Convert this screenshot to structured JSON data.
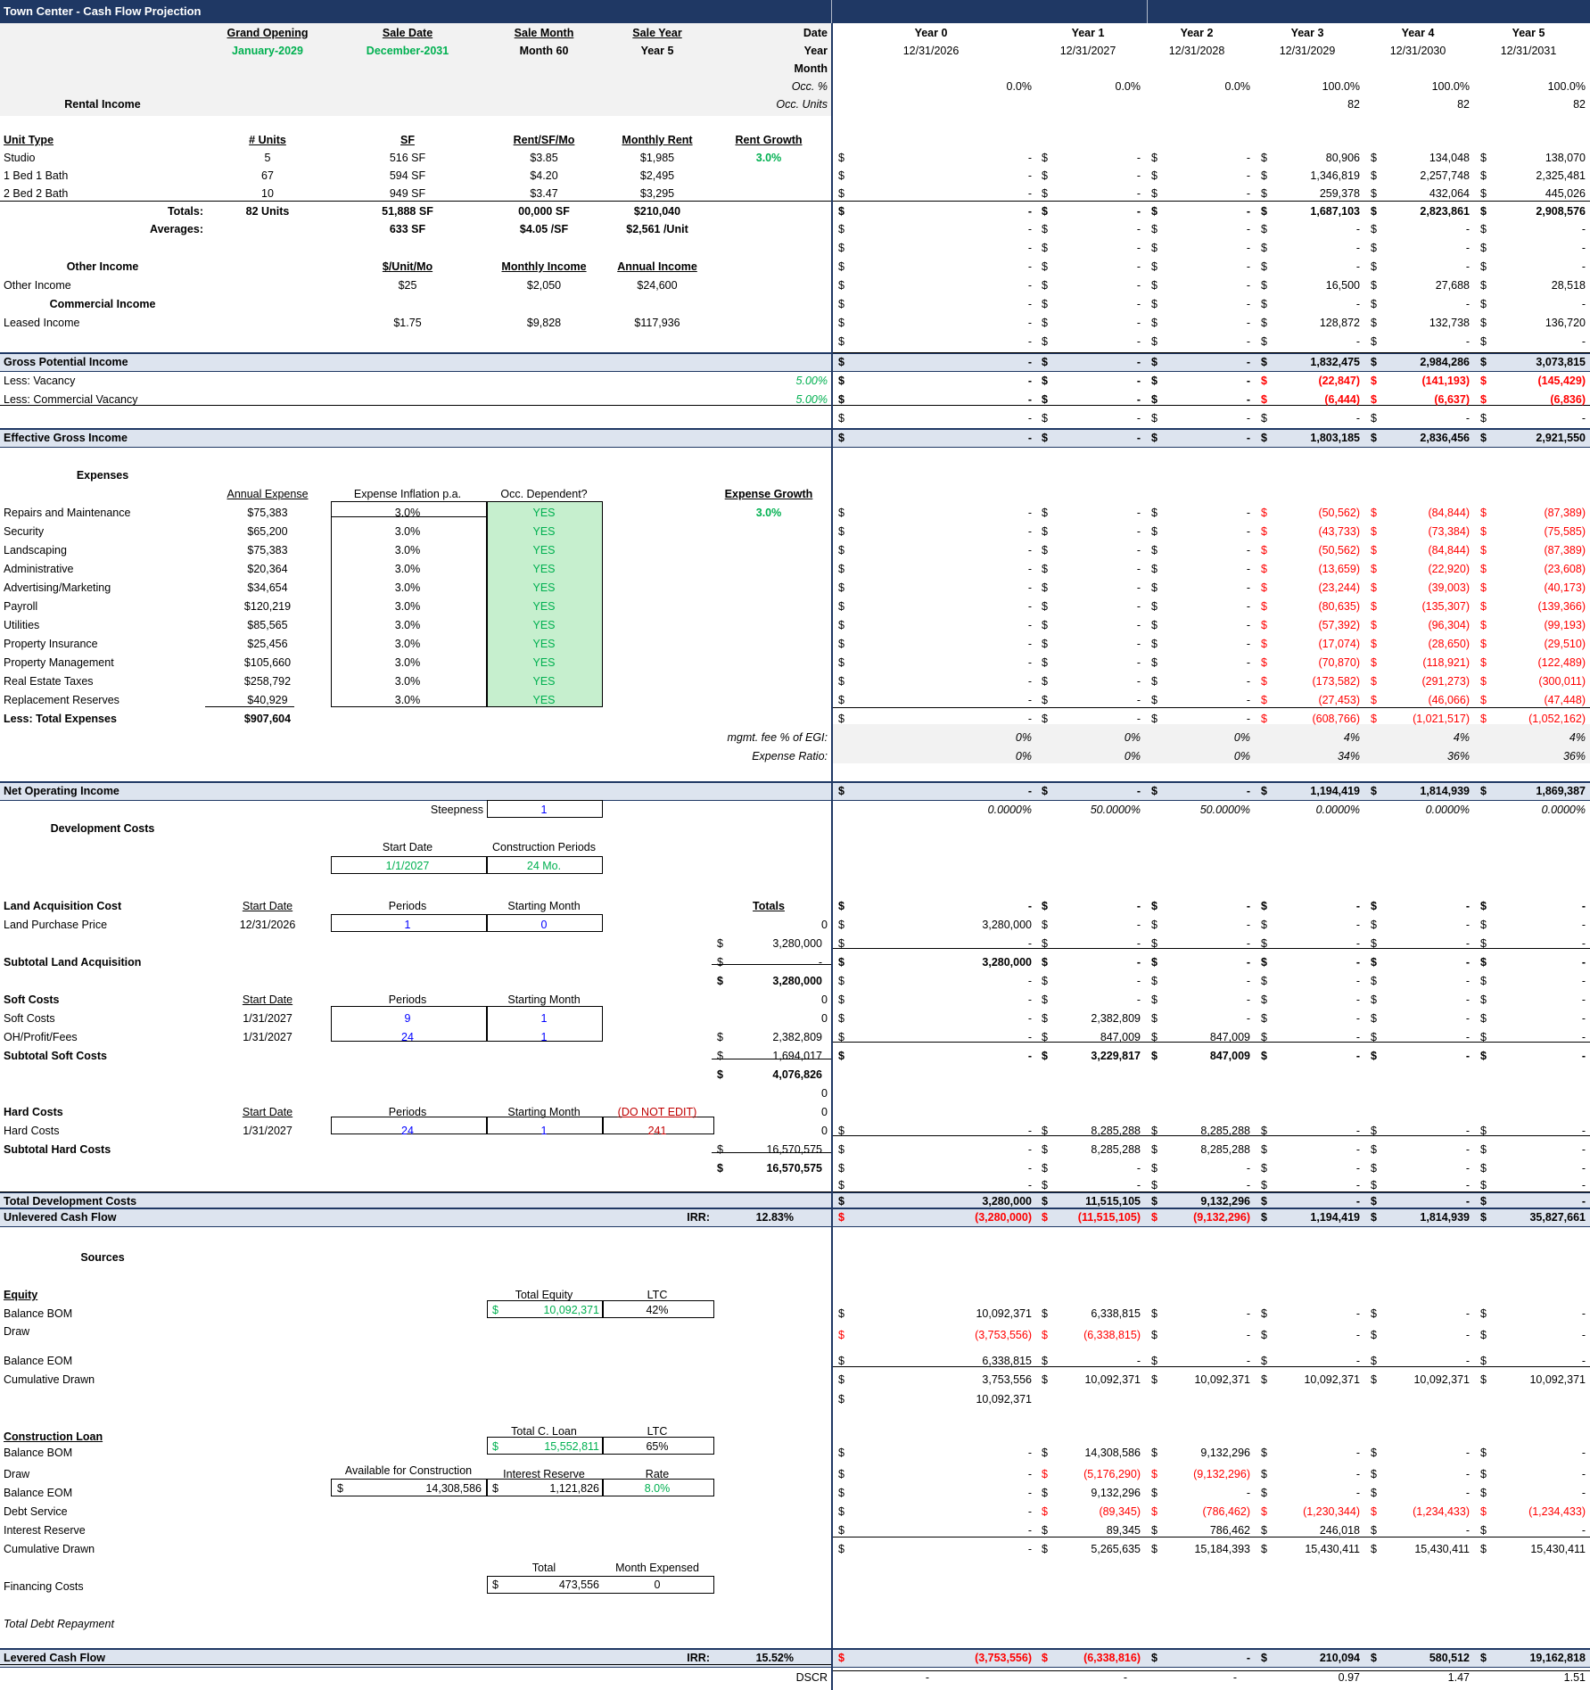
{
  "title": "Town Center - Cash Flow Projection",
  "header": {
    "grand_opening_label": "Grand Opening",
    "grand_opening_value": "January-2029",
    "sale_date_label": "Sale Date",
    "sale_date_value": "December-2031",
    "sale_month_label": "Sale Month",
    "sale_month_value": "Month 60",
    "sale_year_label": "Sale Year",
    "sale_year_value": "Year 5",
    "date_label": "Date",
    "year_label": "Year",
    "month_label": "Month",
    "occ_pct_label": "Occ. %",
    "occ_units_label": "Occ. Units",
    "years": [
      "Year 0",
      "Year 1",
      "Year 2",
      "Year 3",
      "Year 4",
      "Year 5"
    ],
    "dates": [
      "12/31/2026",
      "12/31/2027",
      "12/31/2028",
      "12/31/2029",
      "12/31/2030",
      "12/31/2031"
    ],
    "occ_pct": [
      "0.0%",
      "0.0%",
      "0.0%",
      "100.0%",
      "100.0%",
      "100.0%"
    ],
    "occ_units": [
      "",
      "",
      "",
      "82",
      "82",
      "82"
    ]
  },
  "colors": {
    "header_bar": "#1f3864",
    "band": "#dde4ef",
    "green": "#00b050",
    "red": "#ff0000",
    "yes_fill": "#c6efce"
  },
  "rental": {
    "title": "Rental Income",
    "headers": [
      "Unit Type",
      "# Units",
      "SF",
      "Rent/SF/Mo",
      "Monthly Rent",
      "Rent Growth"
    ],
    "rent_growth": "3.0%",
    "rows": [
      {
        "type": "Studio",
        "units": "5",
        "sf": "516 SF",
        "rent_sf": "$3.85",
        "monthly": "$1,985",
        "cf": [
          "-",
          "-",
          "-",
          "80,906",
          "134,048",
          "138,070"
        ]
      },
      {
        "type": "1 Bed 1 Bath",
        "units": "67",
        "sf": "594 SF",
        "rent_sf": "$4.20",
        "monthly": "$2,495",
        "cf": [
          "-",
          "-",
          "-",
          "1,346,819",
          "2,257,748",
          "2,325,481"
        ]
      },
      {
        "type": "2 Bed 2 Bath",
        "units": "10",
        "sf": "949 SF",
        "rent_sf": "$3.47",
        "monthly": "$3,295",
        "cf": [
          "-",
          "-",
          "-",
          "259,378",
          "432,064",
          "445,026"
        ]
      }
    ],
    "totals": {
      "label": "Totals:",
      "units": "82 Units",
      "sf": "51,888 SF",
      "rent_sf": "00,000 SF",
      "monthly": "$210,040",
      "cf": [
        "-",
        "-",
        "-",
        "1,687,103",
        "2,823,861",
        "2,908,576"
      ]
    },
    "averages": {
      "label": "Averages:",
      "sf": "633 SF",
      "rent_sf": "$4.05 /SF",
      "monthly": "$2,561 /Unit",
      "cf": [
        "-",
        "-",
        "-",
        "-",
        "-",
        "-"
      ]
    },
    "blank_cf": [
      "-",
      "-",
      "-",
      "-",
      "-",
      "-"
    ]
  },
  "other_income": {
    "title": "Other Income",
    "headers": [
      "$/Unit/Mo",
      "Monthly Income",
      "Annual Income"
    ],
    "label": "Other Income",
    "per_unit": "$25",
    "monthly": "$2,050",
    "annual": "$24,600",
    "cf": [
      "-",
      "-",
      "-",
      "16,500",
      "27,688",
      "28,518"
    ],
    "commercial_title": "Commercial Income",
    "commercial_cf": [
      "-",
      "-",
      "-",
      "-",
      "-",
      "-"
    ],
    "leased_label": "Leased Income",
    "leased_per": "$1.75",
    "leased_monthly": "$9,828",
    "leased_annual": "$117,936",
    "leased_cf": [
      "-",
      "-",
      "-",
      "128,872",
      "132,738",
      "136,720"
    ],
    "after_cf": [
      "-",
      "-",
      "-",
      "-",
      "-",
      "-"
    ]
  },
  "gpi": {
    "label": "Gross Potential Income",
    "cf": [
      "-",
      "-",
      "-",
      "1,832,475",
      "2,984,286",
      "3,073,815"
    ]
  },
  "vacancy": {
    "label": "Less: Vacancy",
    "rate": "5.00%",
    "cf": [
      "-",
      "-",
      "-",
      "(22,847)",
      "(141,193)",
      "(145,429)"
    ]
  },
  "comm_vacancy": {
    "label": "Less: Commercial Vacancy",
    "rate": "5.00%",
    "cf": [
      "-",
      "-",
      "-",
      "(6,444)",
      "(6,637)",
      "(6,836)"
    ]
  },
  "blank_after_vac": [
    "-",
    "-",
    "-",
    "-",
    "-",
    "-"
  ],
  "egi": {
    "label": "Effective Gross Income",
    "cf": [
      "-",
      "-",
      "-",
      "1,803,185",
      "2,836,456",
      "2,921,550"
    ]
  },
  "expenses": {
    "title": "Expenses",
    "headers": [
      "Annual Expense",
      "Expense Inflation p.a.",
      "Occ. Dependent?",
      "Expense Growth"
    ],
    "growth": "3.0%",
    "rows": [
      {
        "name": "Repairs and Maintenance",
        "annual": "$75,383",
        "infl": "3.0%",
        "occ": "YES",
        "cf": [
          "-",
          "-",
          "-",
          "(50,562)",
          "(84,844)",
          "(87,389)"
        ]
      },
      {
        "name": "Security",
        "annual": "$65,200",
        "infl": "3.0%",
        "occ": "YES",
        "cf": [
          "-",
          "-",
          "-",
          "(43,733)",
          "(73,384)",
          "(75,585)"
        ]
      },
      {
        "name": "Landscaping",
        "annual": "$75,383",
        "infl": "3.0%",
        "occ": "YES",
        "cf": [
          "-",
          "-",
          "-",
          "(50,562)",
          "(84,844)",
          "(87,389)"
        ]
      },
      {
        "name": "Administrative",
        "annual": "$20,364",
        "infl": "3.0%",
        "occ": "YES",
        "cf": [
          "-",
          "-",
          "-",
          "(13,659)",
          "(22,920)",
          "(23,608)"
        ]
      },
      {
        "name": "Advertising/Marketing",
        "annual": "$34,654",
        "infl": "3.0%",
        "occ": "YES",
        "cf": [
          "-",
          "-",
          "-",
          "(23,244)",
          "(39,003)",
          "(40,173)"
        ]
      },
      {
        "name": "Payroll",
        "annual": "$120,219",
        "infl": "3.0%",
        "occ": "YES",
        "cf": [
          "-",
          "-",
          "-",
          "(80,635)",
          "(135,307)",
          "(139,366)"
        ]
      },
      {
        "name": "Utilities",
        "annual": "$85,565",
        "infl": "3.0%",
        "occ": "YES",
        "cf": [
          "-",
          "-",
          "-",
          "(57,392)",
          "(96,304)",
          "(99,193)"
        ]
      },
      {
        "name": "Property Insurance",
        "annual": "$25,456",
        "infl": "3.0%",
        "occ": "YES",
        "cf": [
          "-",
          "-",
          "-",
          "(17,074)",
          "(28,650)",
          "(29,510)"
        ]
      },
      {
        "name": "Property Management",
        "annual": "$105,660",
        "infl": "3.0%",
        "occ": "YES",
        "cf": [
          "-",
          "-",
          "-",
          "(70,870)",
          "(118,921)",
          "(122,489)"
        ]
      },
      {
        "name": "Real Estate Taxes",
        "annual": "$258,792",
        "infl": "3.0%",
        "occ": "YES",
        "cf": [
          "-",
          "-",
          "-",
          "(173,582)",
          "(291,273)",
          "(300,011)"
        ]
      },
      {
        "name": "Replacement Reserves",
        "annual": "$40,929",
        "infl": "3.0%",
        "occ": "YES",
        "cf": [
          "-",
          "-",
          "-",
          "(27,453)",
          "(46,066)",
          "(47,448)"
        ]
      }
    ],
    "total_label": "Less: Total Expenses",
    "total": "$907,604",
    "total_cf": [
      "-",
      "-",
      "-",
      "(608,766)",
      "(1,021,517)",
      "(1,052,162)"
    ],
    "mgmt_label": "mgmt. fee % of EGI:",
    "mgmt": [
      "0%",
      "0%",
      "0%",
      "4%",
      "4%",
      "4%"
    ],
    "ratio_label": "Expense Ratio:",
    "ratio": [
      "0%",
      "0%",
      "0%",
      "34%",
      "36%",
      "36%"
    ]
  },
  "noi": {
    "label": "Net Operating Income",
    "cf": [
      "-",
      "-",
      "-",
      "1,194,419",
      "1,814,939",
      "1,869,387"
    ]
  },
  "steepness": {
    "label": "Steepness",
    "value": "1",
    "pcts": [
      "0.0000%",
      "50.0000%",
      "50.0000%",
      "0.0000%",
      "0.0000%",
      "0.0000%"
    ]
  },
  "dev": {
    "title": "Development Costs",
    "start_date_label": "Start Date",
    "start_date": "1/1/2027",
    "periods_label": "Construction Periods",
    "periods": "24 Mo.",
    "land_title": "Land Acquisition Cost",
    "col_start": "Start Date",
    "col_periods": "Periods",
    "col_start_month": "Starting Month",
    "col_totals": "Totals",
    "land_header_cf": [
      "-",
      "-",
      "-",
      "-",
      "-",
      "-"
    ],
    "land_label": "Land Purchase Price",
    "land_start": "12/31/2026",
    "land_periods": "1",
    "land_month": "0",
    "land_zero": "0",
    "land_cf": [
      "3,280,000",
      "-",
      "-",
      "-",
      "-",
      "-"
    ],
    "land_total_1": "3,280,000",
    "land_blank_cf": [
      "-",
      "-",
      "-",
      "-",
      "-",
      "-"
    ],
    "land_subtotal_label": "Subtotal Land Acquisition",
    "land_subtotal_mid": "-",
    "land_subtotal_cf": [
      "3,280,000",
      "-",
      "-",
      "-",
      "-",
      "-"
    ],
    "land_total_2": "3,280,000",
    "land_after_cf": [
      "-",
      "-",
      "-",
      "-",
      "-",
      "-"
    ],
    "soft_title": "Soft Costs",
    "soft_zero_1": "0",
    "soft_header_cf": [
      "-",
      "-",
      "-",
      "-",
      "-",
      "-"
    ],
    "soft_label": "Soft Costs",
    "soft_start": "1/31/2027",
    "soft_periods": "9",
    "soft_month": "1",
    "soft_zero_2": "0",
    "soft_cf": [
      "-",
      "2,382,809",
      "-",
      "-",
      "-",
      "-"
    ],
    "oh_label": "OH/Profit/Fees",
    "oh_start": "1/31/2027",
    "oh_periods": "24",
    "oh_month": "1",
    "oh_total": "2,382,809",
    "oh_cf": [
      "-",
      "847,009",
      "847,009",
      "-",
      "-",
      "-"
    ],
    "soft_subtotal_label": "Subtotal Soft Costs",
    "soft_subtotal_mid": "1,694,017",
    "soft_subtotal_cf": [
      "-",
      "3,229,817",
      "847,009",
      "-",
      "-",
      "-"
    ],
    "soft_total": "4,076,826",
    "hard_zero_1": "0",
    "hard_title": "Hard Costs",
    "hard_zero_2": "0",
    "do_not_edit": "(DO NOT EDIT)",
    "hard_label": "Hard Costs",
    "hard_start": "1/31/2027",
    "hard_periods": "24",
    "hard_month": "1",
    "hard_lock": "241",
    "hard_zero_3": "0",
    "hard_cf": [
      "-",
      "8,285,288",
      "8,285,288",
      "-",
      "-",
      "-"
    ],
    "hard_subtotal_label": "Subtotal Hard Costs",
    "hard_subtotal_mid": "16,570,575",
    "hard_subtotal_cf": [
      "-",
      "8,285,288",
      "8,285,288",
      "-",
      "-",
      "-"
    ],
    "hard_total": "16,570,575",
    "hard_after_1": [
      "-",
      "-",
      "-",
      "-",
      "-",
      "-"
    ],
    "hard_after_2": [
      "-",
      "-",
      "-",
      "-",
      "-",
      "-"
    ],
    "total_label": "Total Development Costs",
    "total_cf": [
      "3,280,000",
      "11,515,105",
      "9,132,296",
      "-",
      "-",
      "-"
    ]
  },
  "unlevered": {
    "label": "Unlevered Cash Flow",
    "irr_label": "IRR:",
    "irr": "12.83%",
    "cf": [
      "(3,280,000)",
      "(11,515,105)",
      "(9,132,296)",
      "1,194,419",
      "1,814,939",
      "35,827,661"
    ]
  },
  "sources": {
    "title": "Sources",
    "equity_title": "Equity",
    "total_equity_label": "Total Equity",
    "ltc_label": "LTC",
    "total_equity": "10,092,371",
    "equity_ltc": "42%",
    "bom_label": "Balance BOM",
    "equity_bom": [
      "10,092,371",
      "6,338,815",
      "-",
      "-",
      "-",
      "-"
    ],
    "draw_label": "Draw",
    "equity_draw": [
      "(3,753,556)",
      "(6,338,815)",
      "-",
      "-",
      "-",
      "-"
    ],
    "eom_label": "Balance EOM",
    "equity_eom": [
      "6,338,815",
      "-",
      "-",
      "-",
      "-",
      "-"
    ],
    "cum_label": "Cumulative Drawn",
    "equity_cum": [
      "3,753,556",
      "10,092,371",
      "10,092,371",
      "10,092,371",
      "10,092,371",
      "10,092,371"
    ],
    "equity_extra": "10,092,371",
    "loan_title": "Construction Loan",
    "total_loan_label": "Total C. Loan",
    "total_loan": "15,552,811",
    "loan_ltc": "65%",
    "loan_bom": [
      "-",
      "14,308,586",
      "9,132,296",
      "-",
      "-",
      "-"
    ],
    "avail_label": "Available for Construction",
    "avail": "14,308,586",
    "ir_label": "Interest Reserve",
    "ir_value": "1,121,826",
    "rate_label": "Rate",
    "rate": "8.0%",
    "loan_draw": [
      "-",
      "(5,176,290)",
      "(9,132,296)",
      "-",
      "-",
      "-"
    ],
    "loan_eom": [
      "-",
      "9,132,296",
      "-",
      "-",
      "-",
      "-"
    ],
    "ds_label": "Debt Service",
    "loan_ds": [
      "-",
      "(89,345)",
      "(786,462)",
      "(1,230,344)",
      "(1,234,433)",
      "(1,234,433)"
    ],
    "ir_row_label": "Interest Reserve",
    "loan_ir": [
      "-",
      "89,345",
      "786,462",
      "246,018",
      "-",
      "-"
    ],
    "loan_cum": [
      "-",
      "5,265,635",
      "15,184,393",
      "15,430,411",
      "15,430,411",
      "15,430,411"
    ],
    "fin_total_label": "Total",
    "fin_month_label": "Month Expensed",
    "fin_label": "Financing Costs",
    "fin_total": "473,556",
    "fin_month": "0",
    "repay_label": "Total Debt Repayment"
  },
  "levered": {
    "label": "Levered Cash Flow",
    "irr_label": "IRR:",
    "irr": "15.52%",
    "cf": [
      "(3,753,556)",
      "(6,338,816)",
      "-",
      "210,094",
      "580,512",
      "19,162,818"
    ]
  },
  "dscr": {
    "label": "DSCR",
    "values": [
      "-",
      "-",
      "-",
      "0.97",
      "1.47",
      "1.51"
    ]
  }
}
